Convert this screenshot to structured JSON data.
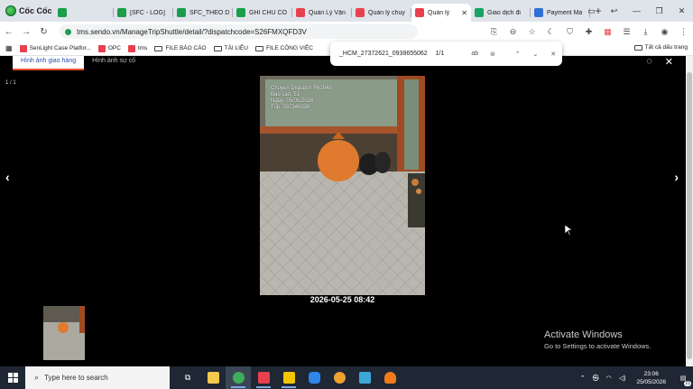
{
  "browser": {
    "name": "Cốc Cốc",
    "tabs": [
      {
        "label": "",
        "color": "#1a9e4b",
        "active": false
      },
      {
        "label": "[SFC - LOG]",
        "color": "#1a9e4b",
        "active": false
      },
      {
        "label": "SFC_THEO D",
        "color": "#1a9e4b",
        "active": false
      },
      {
        "label": "GHI CHÚ CÔ",
        "color": "#1a9e4b",
        "active": false
      },
      {
        "label": "Quản Lý Vận",
        "color": "#e8414d",
        "active": false
      },
      {
        "label": "Quản lý chuy",
        "color": "#e8414d",
        "active": false
      },
      {
        "label": "Quản lý",
        "color": "#e8414d",
        "active": true
      },
      {
        "label": "Giao dịch đi",
        "color": "#19a463",
        "active": false
      },
      {
        "label": "Payment Ma",
        "color": "#2f6fd8",
        "active": false
      }
    ],
    "url": "tms.sendo.vn/ManageTripShuttle/detail/?dispatchcode=S26FMXQFD3V",
    "bookmarks": [
      {
        "label": "SenLight Case Platfor...",
        "kind": "app"
      },
      {
        "label": "OPC",
        "kind": "app"
      },
      {
        "label": "tms",
        "kind": "app"
      },
      {
        "label": "FILE BÁO CÁO",
        "kind": "folder"
      },
      {
        "label": "TÀI LIỆU",
        "kind": "folder"
      },
      {
        "label": "FILE CÔNG VIỆC",
        "kind": "folder"
      }
    ],
    "all_bookmarks": "Tất cả dấu trang"
  },
  "find": {
    "query": "_HCM_27372621_0938655062",
    "count": "1/1",
    "match_case": "ab"
  },
  "viewer": {
    "tabs": [
      "Hình ảnh giao hàng",
      "Hình ảnh sự cố"
    ],
    "counter": "1 / 1",
    "photo_stamp": "Chuyen Dispatch F61543\nBao cao: 51\nNgay: 05/05/2026\nTrip: 337348338",
    "caption": "2026-05-25 08:42"
  },
  "watermark": {
    "title": "Activate Windows",
    "subtitle": "Go to Settings to activate Windows."
  },
  "taskbar": {
    "search_placeholder": "Type here to search",
    "time": "23:06",
    "date": "25/05/2026",
    "notif_count": "21"
  }
}
